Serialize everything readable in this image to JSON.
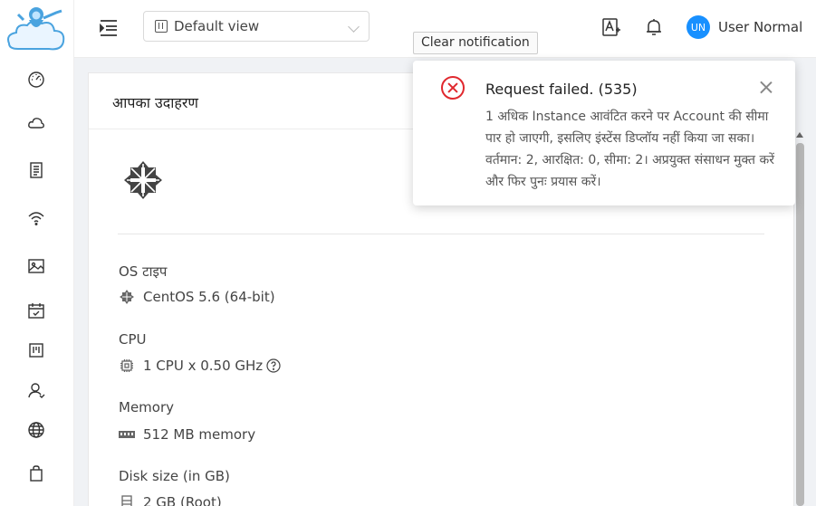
{
  "header": {
    "view_select": "Default view",
    "user": {
      "initials": "UN",
      "name": "User Normal"
    }
  },
  "tooltip": "Clear notification",
  "card": {
    "title": "आपका उदाहरण",
    "fields": {
      "os": {
        "label": "OS टाइप",
        "value": "CentOS 5.6 (64-bit)"
      },
      "cpu": {
        "label": "CPU",
        "value": "1 CPU x 0.50 GHz"
      },
      "memory": {
        "label": "Memory",
        "value": "512 MB memory"
      },
      "disk": {
        "label": "Disk size (in GB)",
        "value": "2 GB (Root)"
      }
    }
  },
  "notification": {
    "title": "Request failed. (535)",
    "message": "1 अधिक Instance आवंटित करने पर Account की सीमा पार हो जाएगी, इसलिए इंस्टेंस डिप्लॉय नहीं किया जा सका। वर्तमान: 2, आरक्षित: 0, सीमा: 2। अप्रयुक्त संसाधन मुक्त करें और फिर पुनः प्रयास करें।"
  },
  "colors": {
    "accent": "#1890ff",
    "error": "#e0282e"
  },
  "icons": [
    "dashboard-icon",
    "cloud-icon",
    "template-icon",
    "network-icon",
    "image-icon",
    "event-icon",
    "project-icon",
    "users-icon",
    "globe-icon",
    "bag-icon",
    "bell-icon",
    "translate-icon",
    "menu-fold-icon"
  ]
}
